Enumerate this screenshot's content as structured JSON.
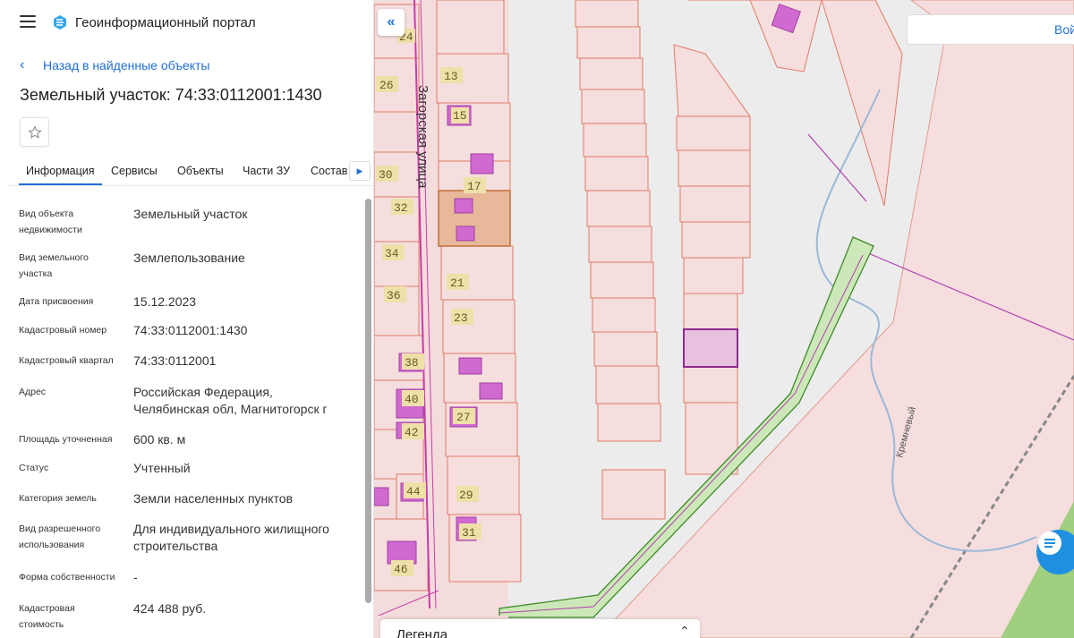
{
  "header": {
    "app_title": "Геоинформационный портал"
  },
  "nav": {
    "back_label": "Назад в найденные объекты"
  },
  "object": {
    "title": "Земельный участок: 74:33:0112001:1430"
  },
  "tabs": [
    {
      "label": "Информация",
      "active": true
    },
    {
      "label": "Сервисы"
    },
    {
      "label": "Объекты"
    },
    {
      "label": "Части ЗУ"
    },
    {
      "label": "Состав"
    }
  ],
  "properties": [
    {
      "label": "Вид объекта недвижимости",
      "value": "Земельный участок"
    },
    {
      "label": "Вид земельного участка",
      "value": "Землепользование"
    },
    {
      "label": "Дата присвоения",
      "value": "15.12.2023"
    },
    {
      "label": "Кадастровый номер",
      "value": "74:33:0112001:1430"
    },
    {
      "label": "Кадастровый квартал",
      "value": "74:33:0112001"
    },
    {
      "label": "Адрес",
      "value": "Российская Федерация, Челябинская обл, Магнитогорск г"
    },
    {
      "label": "Площадь уточненная",
      "value": "600 кв. м"
    },
    {
      "label": "Статус",
      "value": "Учтенный"
    },
    {
      "label": "Категория земель",
      "value": "Земли населенных пунктов"
    },
    {
      "label": "Вид разрешенного использования",
      "value": "Для индивидуального жилищного строительства"
    },
    {
      "label": "Форма собственности",
      "value": "-"
    },
    {
      "label": "Кадастровая стоимость",
      "value": "424 488 руб."
    }
  ],
  "map": {
    "street_name": "Загорская улица",
    "creek_name": "Кремневый",
    "house_numbers": [
      "24",
      "26",
      "13",
      "15",
      "30",
      "17",
      "32",
      "34",
      "21",
      "36",
      "23",
      "38",
      "40",
      "27",
      "42",
      "44",
      "29",
      "31",
      "46"
    ],
    "search_button_label": "Вой",
    "legend_title": "Легенда",
    "colors": {
      "parcel_fill": "#f6dede",
      "parcel_border": "#e07a66",
      "building": "#d06ad0",
      "selected": "#8e2a8e",
      "route": "#66b24a",
      "forest": "#9fcf7f",
      "water": "#9bb8d8",
      "accent": "#1f6fd6"
    }
  }
}
